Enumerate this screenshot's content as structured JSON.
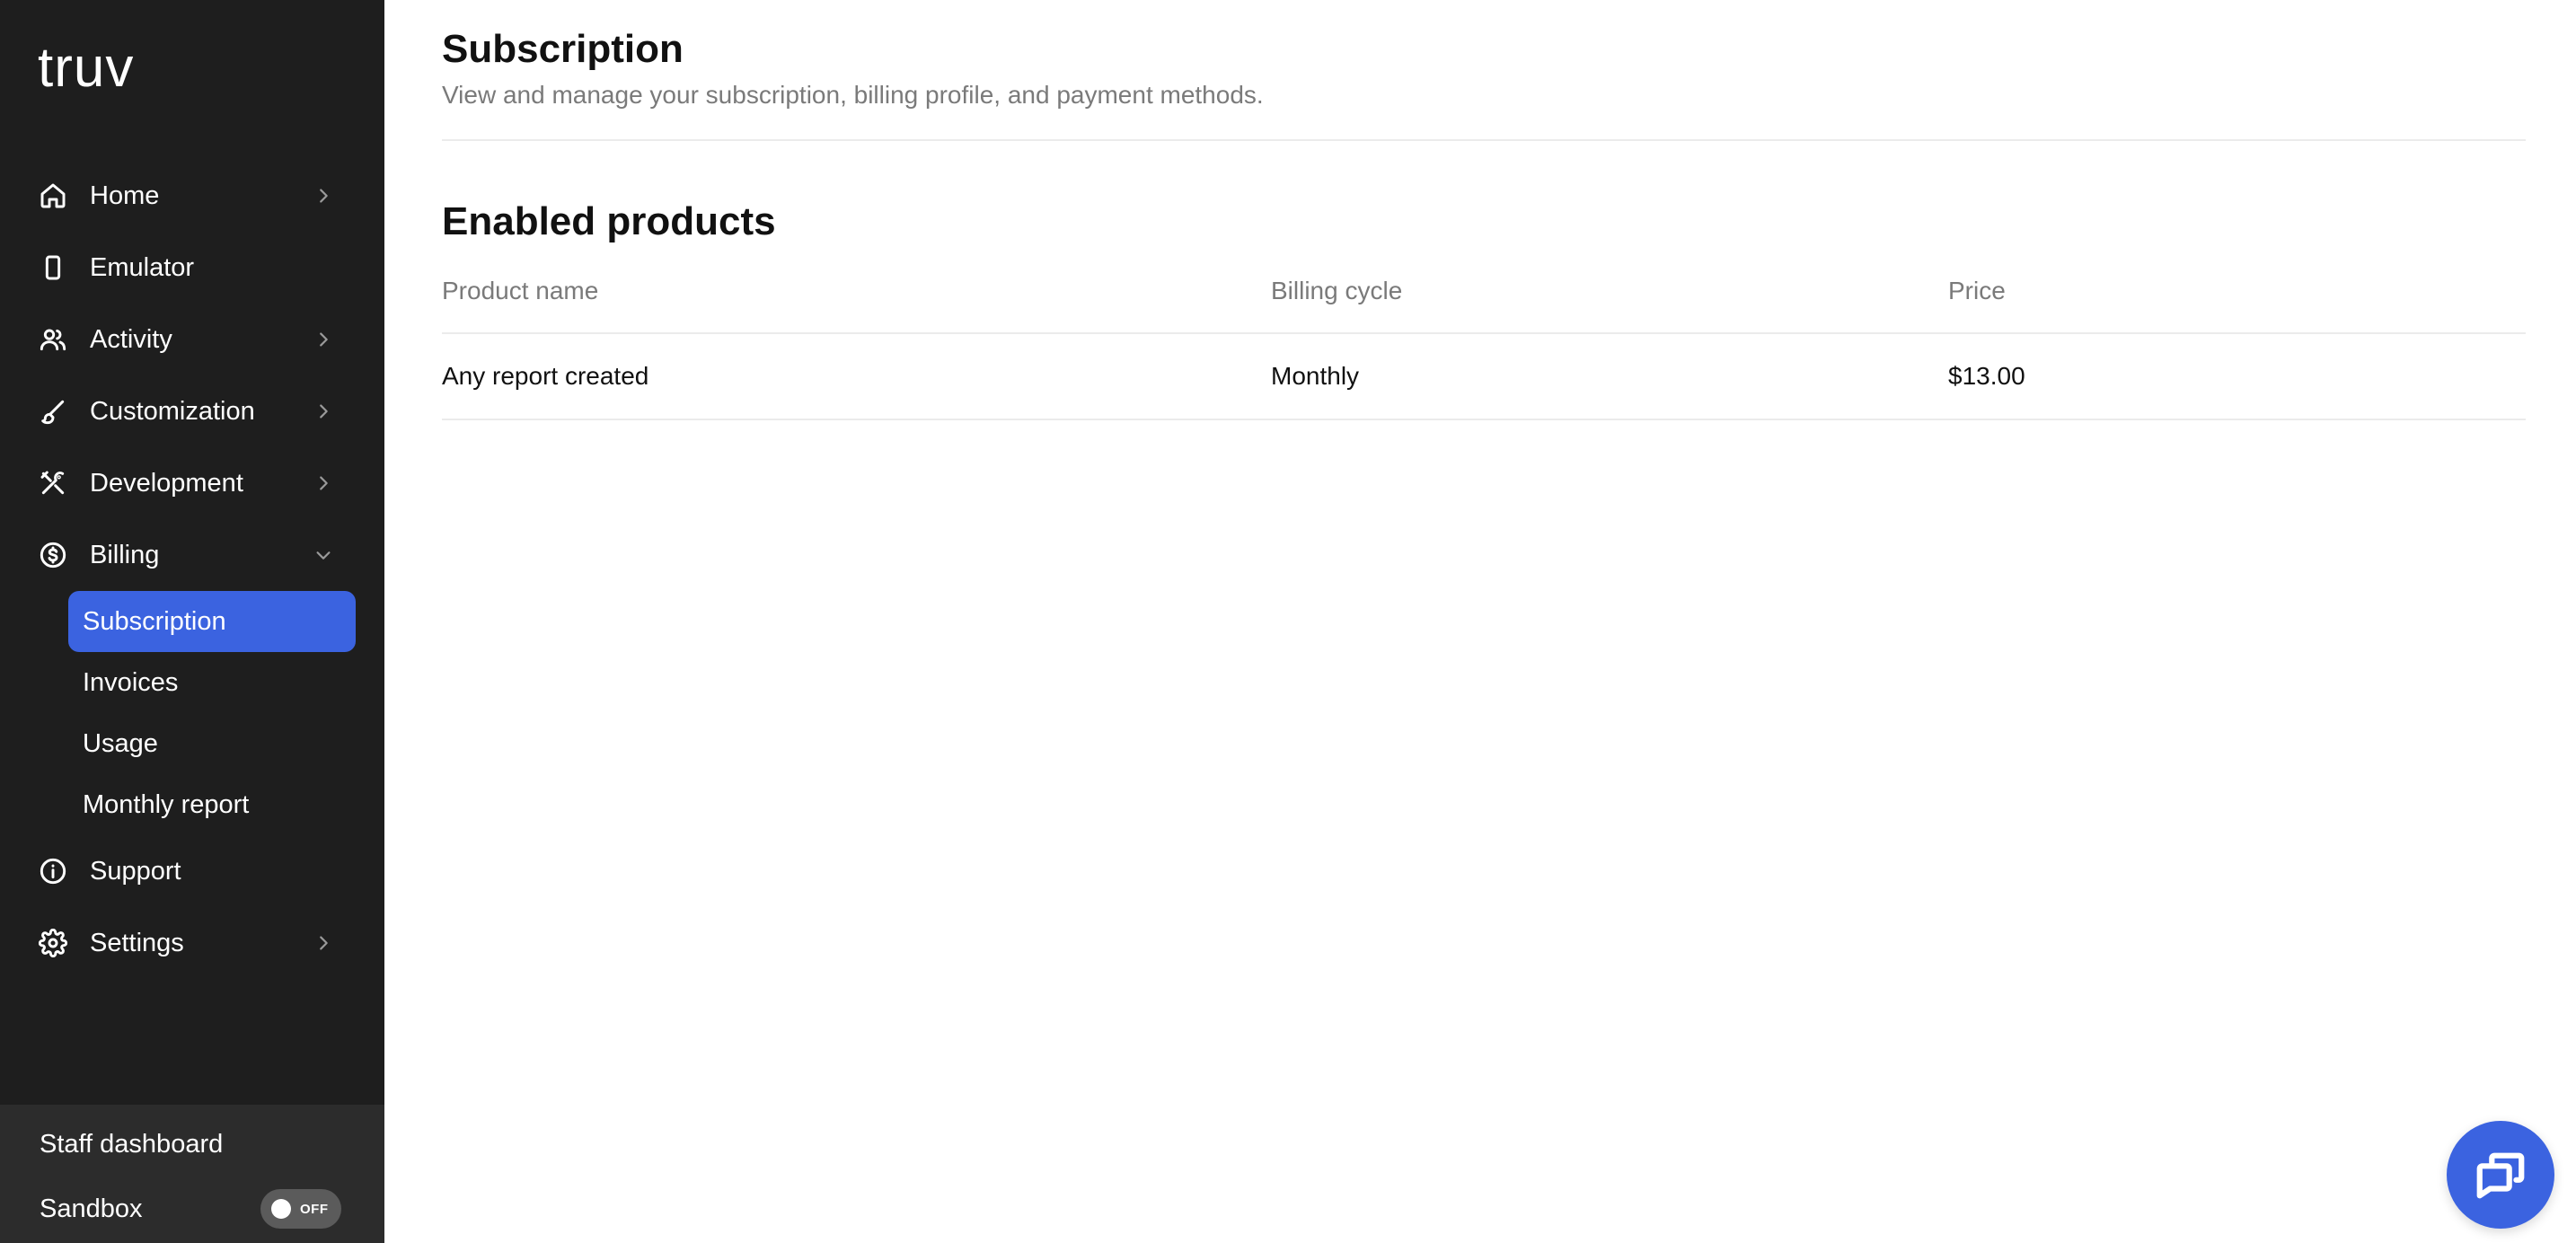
{
  "brand": {
    "logo_text": "truv"
  },
  "sidebar": {
    "items": [
      {
        "label": "Home",
        "icon": "home-icon",
        "chevron": "right"
      },
      {
        "label": "Emulator",
        "icon": "phone-icon"
      },
      {
        "label": "Activity",
        "icon": "users-icon",
        "chevron": "right"
      },
      {
        "label": "Customization",
        "icon": "brush-icon",
        "chevron": "right"
      },
      {
        "label": "Development",
        "icon": "tools-icon",
        "chevron": "right"
      },
      {
        "label": "Billing",
        "icon": "dollar-icon",
        "chevron": "down"
      },
      {
        "label": "Support",
        "icon": "info-icon"
      },
      {
        "label": "Settings",
        "icon": "gear-icon",
        "chevron": "right"
      }
    ],
    "billing_sub": [
      {
        "label": "Subscription",
        "active": true
      },
      {
        "label": "Invoices"
      },
      {
        "label": "Usage"
      },
      {
        "label": "Monthly report"
      }
    ],
    "bottom": {
      "staff_dashboard": "Staff dashboard",
      "sandbox_label": "Sandbox",
      "sandbox_state": "OFF"
    }
  },
  "main": {
    "title": "Subscription",
    "subtitle": "View and manage your subscription, billing profile, and payment methods.",
    "section_title": "Enabled products",
    "table": {
      "headers": [
        "Product name",
        "Billing cycle",
        "Price"
      ],
      "rows": [
        [
          "Any report created",
          "Monthly",
          "$13.00"
        ]
      ]
    }
  },
  "colors": {
    "sidebar_bg": "#1e1e1e",
    "sidebar_bottom_bg": "#2c2c2c",
    "accent": "#3b63e0",
    "muted_text": "#7a7a7a"
  },
  "chat": {
    "icon": "chat-icon"
  }
}
